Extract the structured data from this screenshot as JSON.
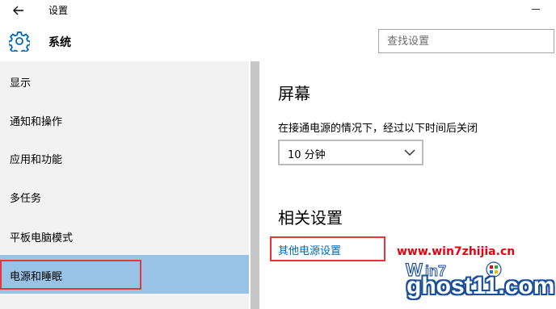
{
  "window": {
    "title": "设置",
    "back_icon": "arrow-left-icon",
    "minimize_icon": "minimize-icon"
  },
  "header": {
    "icon": "gear-icon",
    "title": "系统",
    "search_placeholder": "查找设置"
  },
  "sidebar": {
    "items": [
      {
        "label": "显示",
        "selected": false
      },
      {
        "label": "通知和操作",
        "selected": false
      },
      {
        "label": "应用和功能",
        "selected": false
      },
      {
        "label": "多任务",
        "selected": false
      },
      {
        "label": "平板电脑模式",
        "selected": false
      },
      {
        "label": "电源和睡眠",
        "selected": true
      }
    ]
  },
  "main": {
    "screen_heading": "屏幕",
    "screen_description": "在接通电源的情况下，经过以下时间后关闭",
    "screen_timeout_value": "10 分钟",
    "related_heading": "相关设置",
    "related_link": "其他电源设置"
  },
  "watermark": {
    "url": "www.win7zhijia.cn",
    "ghost": "ghost11.com"
  },
  "colors": {
    "accent": "#99c3e6",
    "link": "#0067b8",
    "highlight_box": "#e8343a",
    "sidebar_bg": "#f2f2f2"
  }
}
